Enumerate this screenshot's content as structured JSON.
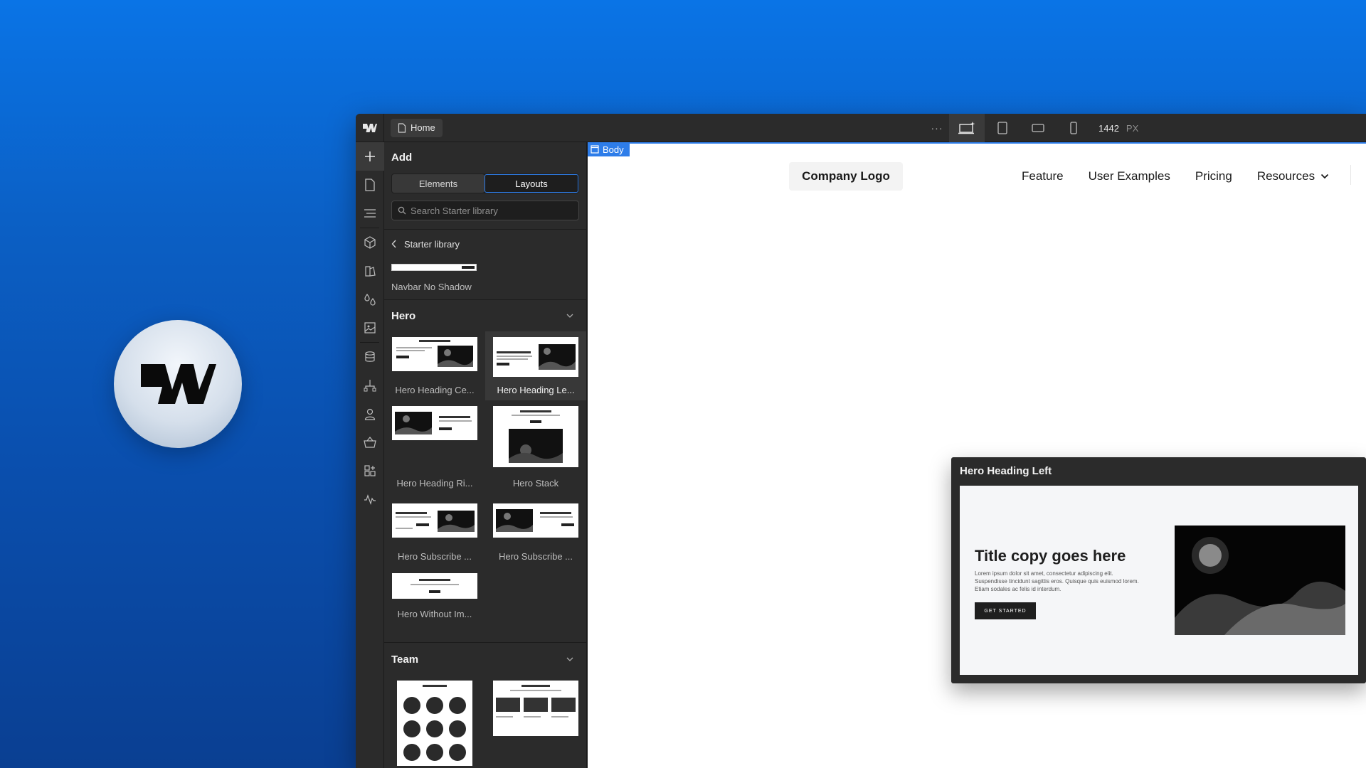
{
  "topbar": {
    "page_name": "Home",
    "more": "···",
    "width_value": "1442",
    "width_unit": "PX"
  },
  "panel": {
    "title": "Add",
    "tabs": [
      "Elements",
      "Layouts"
    ],
    "active_tab": "Layouts",
    "search_placeholder": "Search Starter library",
    "breadcrumb": "Starter library",
    "navbar_item": "Navbar No Shadow",
    "sections": [
      {
        "title": "Hero",
        "items": [
          "Hero Heading Ce...",
          "Hero Heading Le...",
          "Hero Heading Ri...",
          "Hero Stack",
          "Hero Subscribe ...",
          "Hero Subscribe ...",
          "Hero Without Im..."
        ],
        "active_index": 1
      },
      {
        "title": "Team"
      }
    ]
  },
  "canvas": {
    "selected_tag": "Body",
    "site_logo": "Company Logo",
    "nav_links": [
      "Feature",
      "User Examples",
      "Pricing",
      "Resources"
    ]
  },
  "preview": {
    "title": "Hero Heading Left",
    "heading": "Title copy goes here",
    "body": "Lorem ipsum dolor sit amet, consectetur adipiscing elit. Suspendisse tincidunt sagittis eros. Quisque quis euismod lorem. Etiam sodales ac felis id interdum.",
    "button": "GET STARTED"
  },
  "colors": {
    "accent": "#2e7de9",
    "background_blue": "#0a5fc8",
    "panel": "#2b2b2b"
  }
}
